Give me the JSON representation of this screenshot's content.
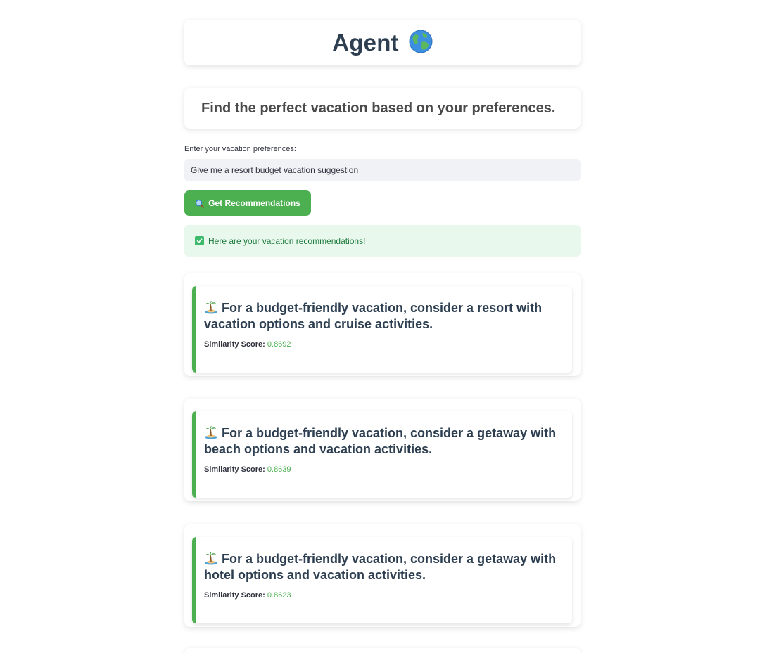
{
  "header": {
    "title": "Agent",
    "title_emoji": "globe-icon"
  },
  "subtitle": "Find the perfect vacation based on your preferences.",
  "form": {
    "label": "Enter your vacation preferences:",
    "value": "Give me a resort budget vacation suggestion",
    "button_label": "Get Recommendations",
    "button_icon": "magnifier-icon"
  },
  "alert": {
    "text": "Here are your vacation recommendations!",
    "icon": "check-box-icon"
  },
  "score_label": "Similarity Score:",
  "recommendations": [
    {
      "icon": "palm-island-icon",
      "text": "For a budget-friendly vacation, consider a resort with vacation options and cruise activities.",
      "score": "0.8692"
    },
    {
      "icon": "palm-island-icon",
      "text": "For a budget-friendly vacation, consider a getaway with beach options and vacation activities.",
      "score": "0.8639"
    },
    {
      "icon": "palm-island-icon",
      "text": "For a budget-friendly vacation, consider a getaway with hotel options and vacation activities.",
      "score": "0.8623"
    }
  ],
  "colors": {
    "accent": "#4caf50",
    "alert_bg": "#e8f8ec",
    "alert_text": "#1e7a3d",
    "heading": "#2c3e50",
    "input_bg": "#f0f2f6"
  }
}
